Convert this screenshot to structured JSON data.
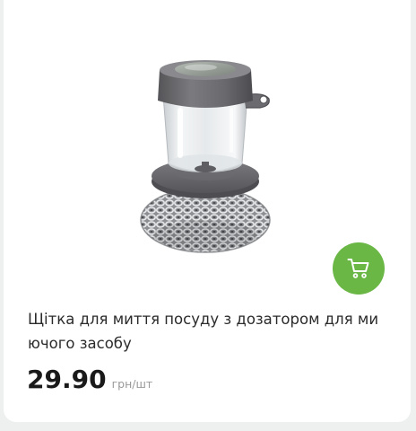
{
  "product": {
    "image_alt": "brush-with-soap-dispenser",
    "title": "Щітка для миття посуду з дозатором для ми ючого засобу",
    "price": "29.90",
    "unit": "грн/шт"
  },
  "actions": {
    "add_to_cart_icon": "cart-icon"
  },
  "colors": {
    "accent": "#6ab746",
    "background": "#eef0ef",
    "card": "#ffffff",
    "text": "#2b2b2b",
    "muted": "#9a9a9a"
  }
}
